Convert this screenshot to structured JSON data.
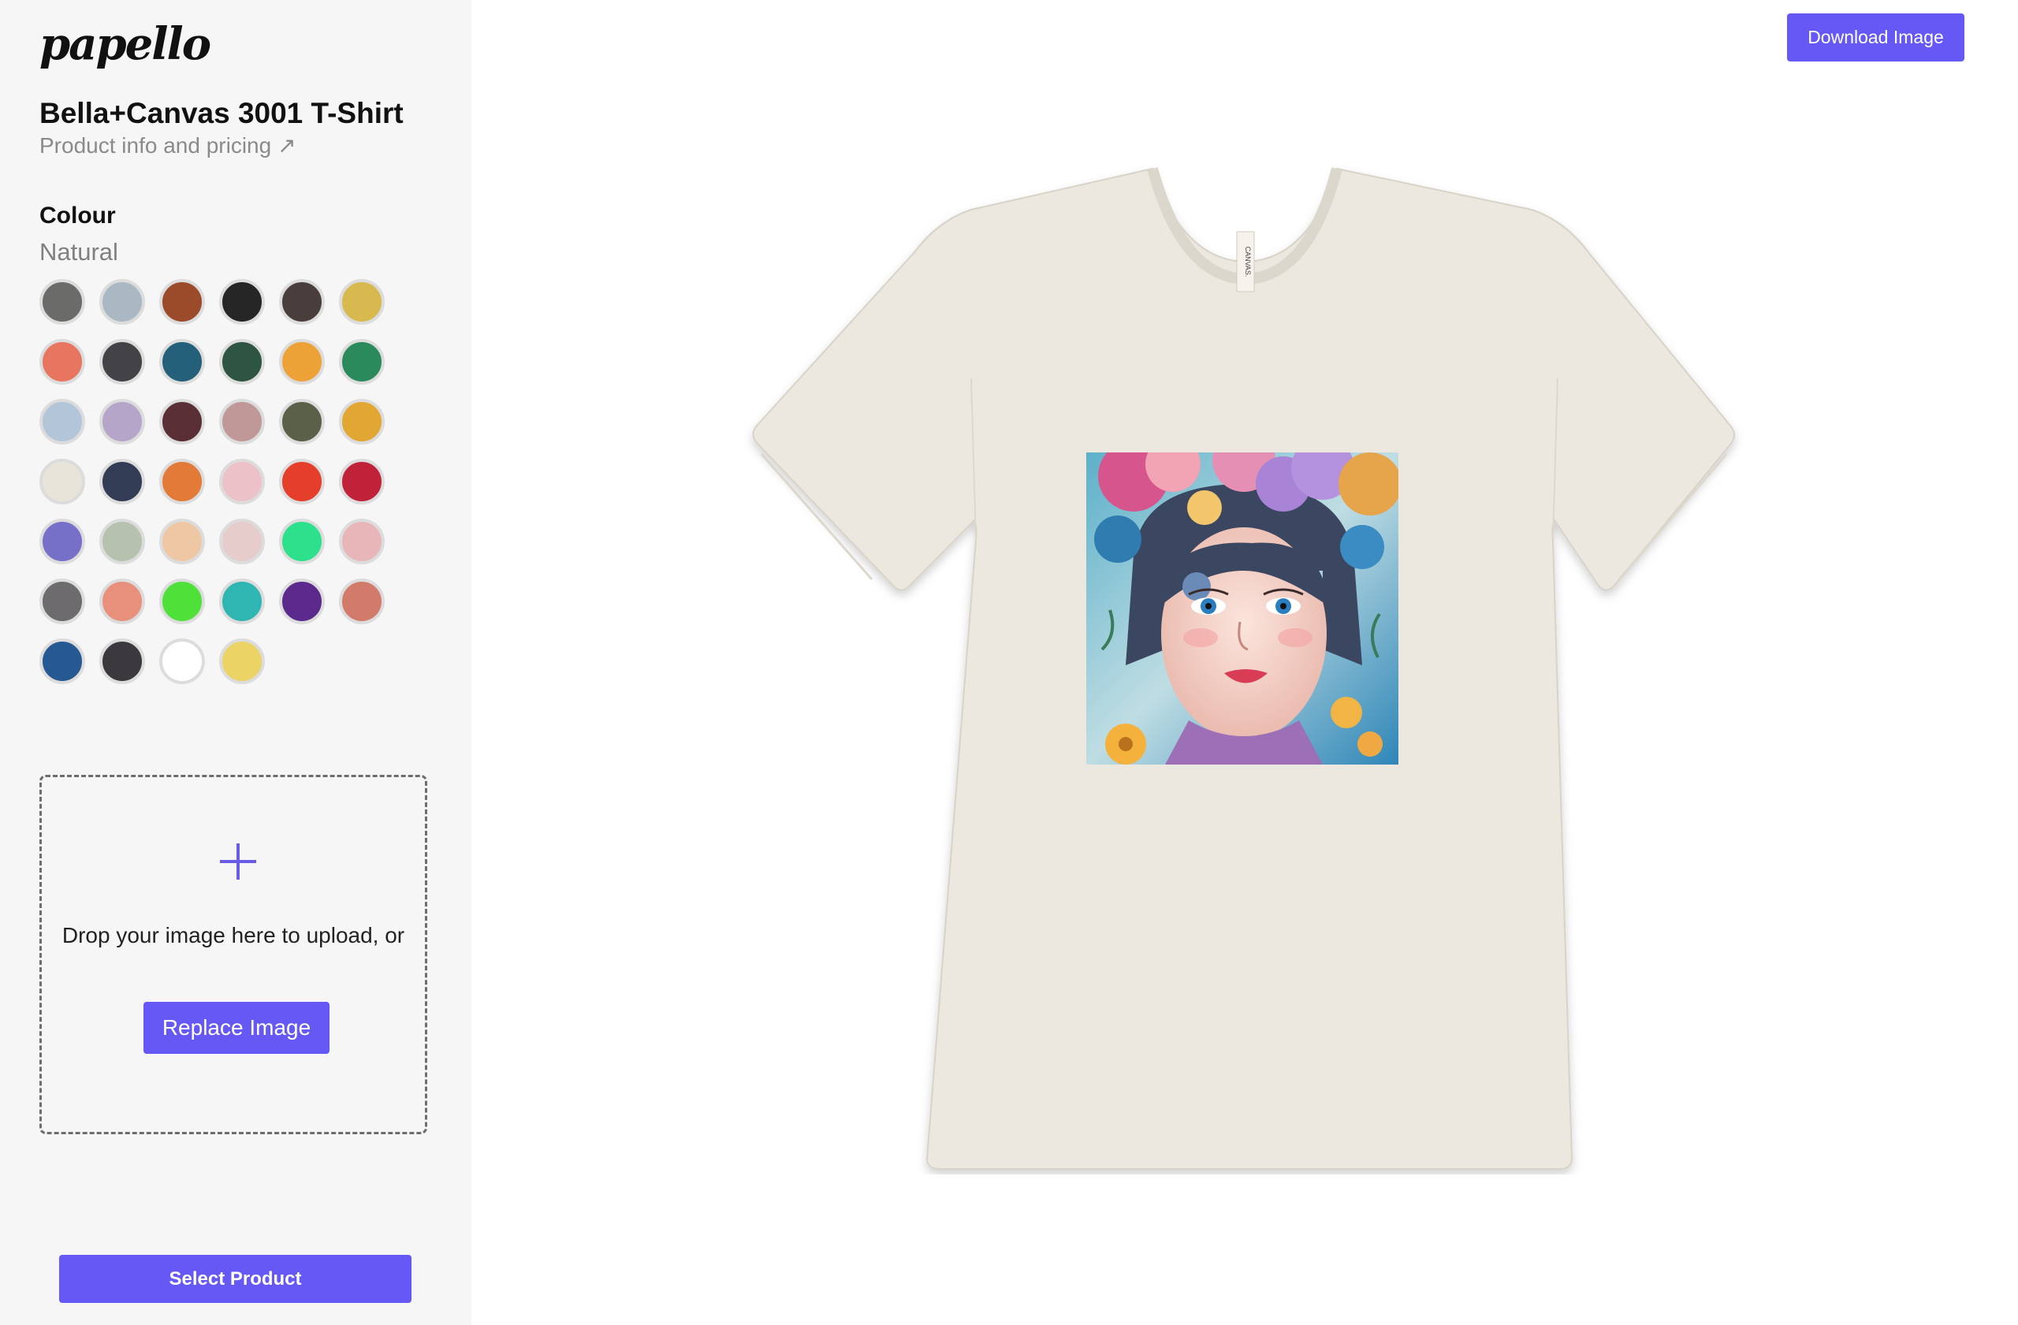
{
  "brand": {
    "logo_text": "papello"
  },
  "product": {
    "title": "Bella+Canvas 3001 T-Shirt",
    "info_link": "Product info and pricing ↗"
  },
  "colour": {
    "label": "Colour",
    "selected": "Natural",
    "swatches": [
      "#6b6c69",
      "#a9b8c3",
      "#9b4a2a",
      "#262626",
      "#4a3e3d",
      "#d7b94f",
      "#e77560",
      "#434347",
      "#25607a",
      "#2e5442",
      "#eda238",
      "#2a8a5b",
      "#b3c6d9",
      "#b5a5c9",
      "#5a2e35",
      "#c09898",
      "#5a6148",
      "#e2a633",
      "#e8e4da",
      "#323c55",
      "#e47a37",
      "#ecc1c8",
      "#e53e2b",
      "#c0223a",
      "#7670c8",
      "#b6c2ad",
      "#eec8a4",
      "#e6cdcb",
      "#2de08c",
      "#e8b6b9",
      "#6d6b6d",
      "#e8907b",
      "#4fe13a",
      "#2fb6b3",
      "#5c2a8c",
      "#d37b6b",
      "#265891",
      "#3b393d",
      "#ffffff",
      "#ebd365"
    ]
  },
  "upload": {
    "drop_text": "Drop your image here to upload, or",
    "replace_label": "Replace Image"
  },
  "actions": {
    "select_label": "Select Product",
    "download_label": "Download Image"
  },
  "mockup": {
    "shirt_color": "#ece8df",
    "neck_label": "CANVAS."
  }
}
